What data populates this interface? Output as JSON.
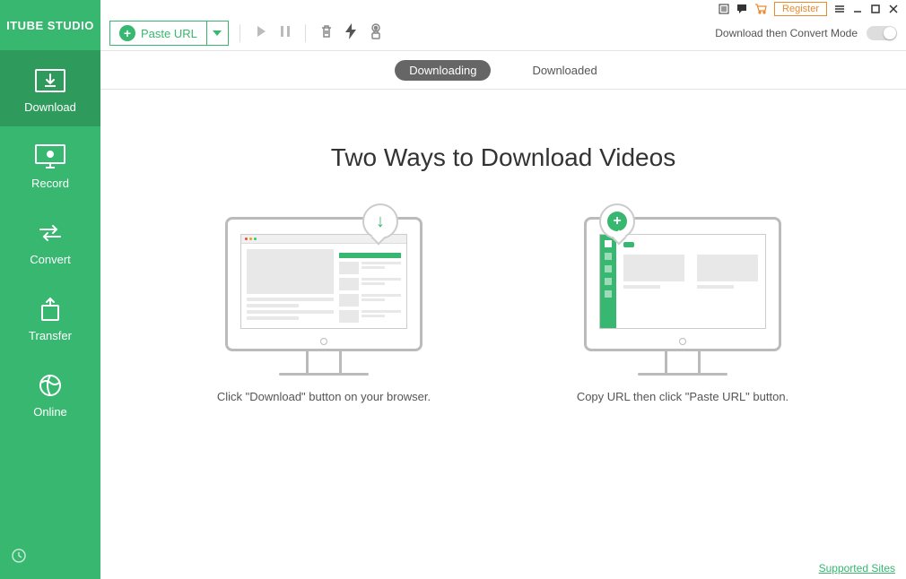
{
  "app": {
    "name": "ITUBE STUDIO"
  },
  "sidebar": {
    "items": [
      {
        "label": "Download"
      },
      {
        "label": "Record"
      },
      {
        "label": "Convert"
      },
      {
        "label": "Transfer"
      },
      {
        "label": "Online"
      }
    ]
  },
  "titlebar": {
    "register": "Register"
  },
  "toolbar": {
    "paste_url": "Paste URL",
    "mode_label": "Download then Convert Mode"
  },
  "tabs": {
    "downloading": "Downloading",
    "downloaded": "Downloaded"
  },
  "content": {
    "headline": "Two Ways to Download Videos",
    "method1_caption": "Click \"Download\" button on your browser.",
    "method2_caption": "Copy URL then click \"Paste URL\" button."
  },
  "footer": {
    "supported_sites": "Supported Sites"
  }
}
